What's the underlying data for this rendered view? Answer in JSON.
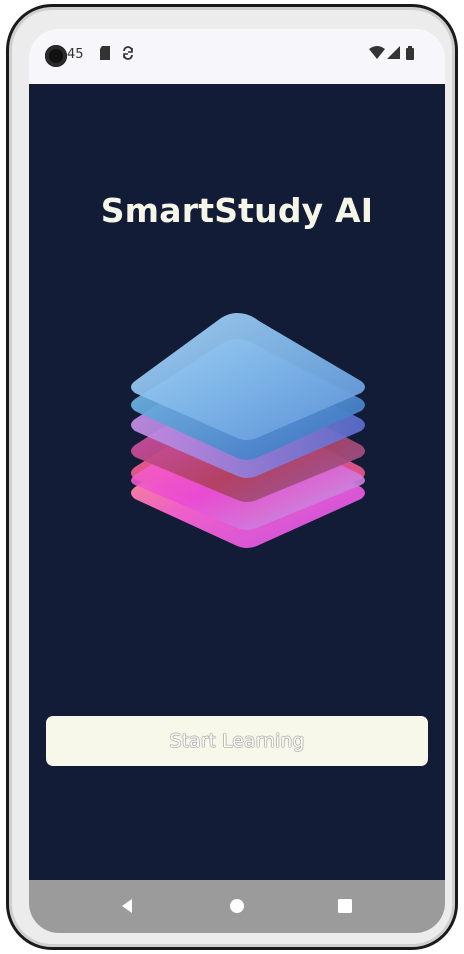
{
  "status_bar": {
    "time": "45",
    "icons": [
      "sd-card-icon",
      "sync-icon",
      "wifi-icon",
      "cellular-signal-icon",
      "battery-icon"
    ]
  },
  "app": {
    "title": "SmartStudy AI",
    "logo": "layered-stack-logo",
    "start_button_label": "Start Learning",
    "background_color": "#121c36",
    "button_color": "#f8f8ea"
  },
  "nav_bar": {
    "buttons": [
      "back-icon",
      "home-icon",
      "recents-icon"
    ]
  }
}
